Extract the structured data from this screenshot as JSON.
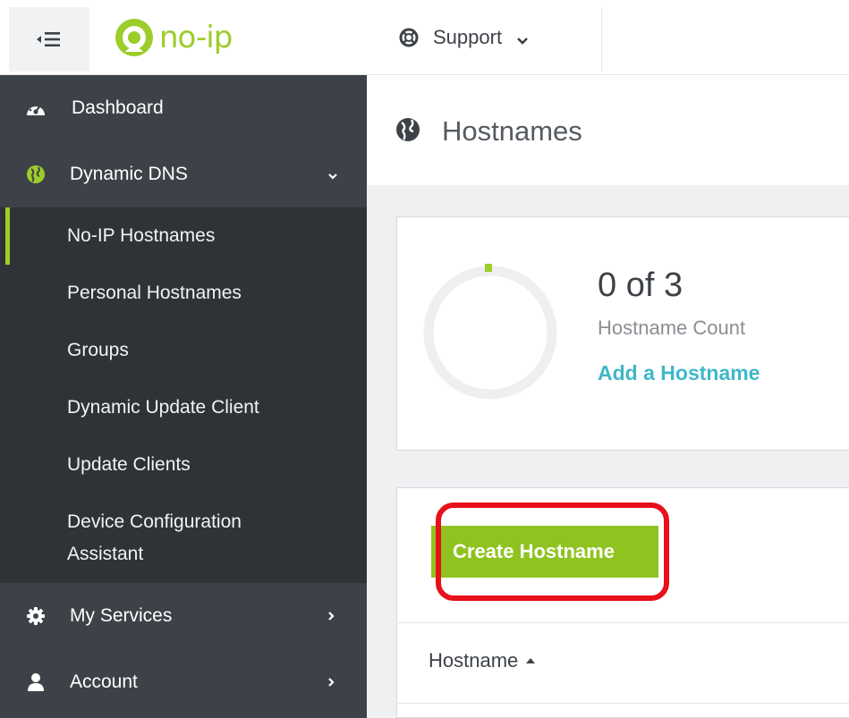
{
  "app": {
    "logo_text": "no-ip"
  },
  "topbar": {
    "support_label": "Support"
  },
  "sidebar": {
    "items": [
      {
        "label": "Dashboard",
        "icon": "dashboard-icon"
      },
      {
        "label": "Dynamic DNS",
        "icon": "globe-icon",
        "expanded": true
      },
      {
        "label": "My Services",
        "icon": "gear-icon"
      },
      {
        "label": "Account",
        "icon": "user-icon"
      }
    ],
    "submenu": [
      {
        "label": "No-IP Hostnames",
        "active": true
      },
      {
        "label": "Personal Hostnames"
      },
      {
        "label": "Groups"
      },
      {
        "label": "Dynamic Update Client"
      },
      {
        "label": "Update Clients"
      },
      {
        "label": "Device Configuration Assistant"
      }
    ]
  },
  "page": {
    "title": "Hostnames"
  },
  "hostname_count": {
    "value_text": "0 of 3",
    "label": "Hostname Count",
    "add_link": "Add a Hostname",
    "used": 0,
    "total": 3
  },
  "actions": {
    "create_hostname": "Create Hostname"
  },
  "table": {
    "columns": [
      {
        "label": "Hostname",
        "sort": "ascending"
      }
    ]
  },
  "colors": {
    "brand_green": "#9ccd2a",
    "button_green": "#8fc31f",
    "link_teal": "#3fb7c9",
    "highlight_red": "#e8101a",
    "sidebar_dark": "#3d4248",
    "submenu_dark": "#2f3337"
  }
}
